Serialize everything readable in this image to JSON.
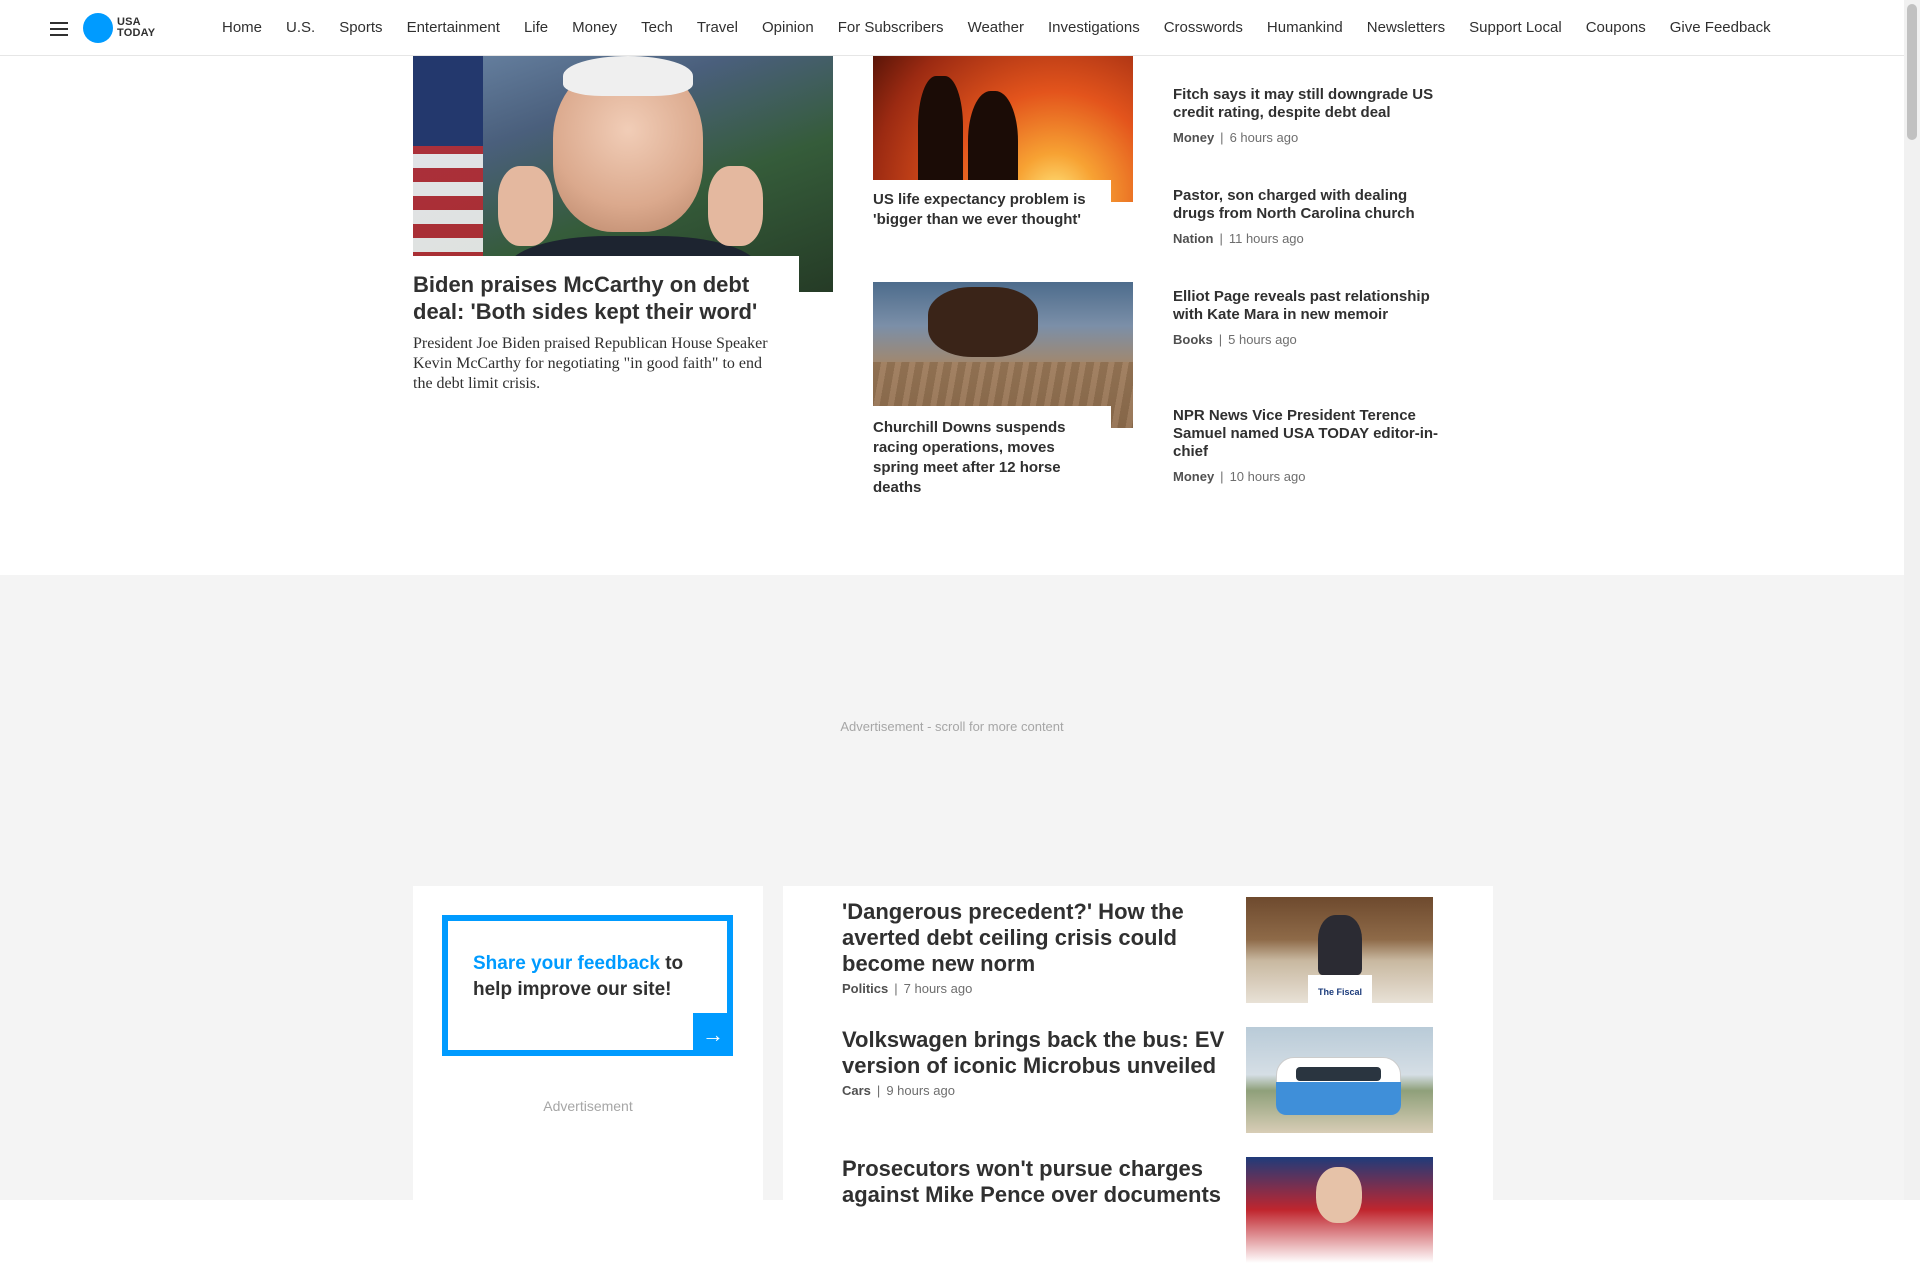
{
  "nav": {
    "logo_line1": "USA",
    "logo_line2": "TODAY",
    "links": [
      "Home",
      "U.S.",
      "Sports",
      "Entertainment",
      "Life",
      "Money",
      "Tech",
      "Travel",
      "Opinion",
      "For Subscribers",
      "Weather",
      "Investigations",
      "Crosswords",
      "Humankind",
      "Newsletters",
      "Support Local",
      "Coupons",
      "Give Feedback"
    ]
  },
  "lead": {
    "title": "Biden praises McCarthy on debt deal: 'Both sides kept their word'",
    "summary": "President Joe Biden praised Republican House Speaker Kevin McCarthy for negotiating \"in good faith\" to end the debt limit crisis."
  },
  "mid_stories": [
    {
      "title": "US life expectancy problem is 'bigger than we ever thought'"
    },
    {
      "title": "Churchill Downs suspends racing operations, moves spring meet after 12 horse deaths"
    }
  ],
  "right_stories": [
    {
      "title": "Fitch says it may still downgrade US credit rating, despite debt deal",
      "category": "Money",
      "time": "6 hours ago"
    },
    {
      "title": "Pastor, son charged with dealing drugs from North Carolina church",
      "category": "Nation",
      "time": "11 hours ago"
    },
    {
      "title": "Elliot Page reveals past relationship with Kate Mara in new memoir",
      "category": "Books",
      "time": "5 hours ago"
    },
    {
      "title": "NPR News Vice President Terence Samuel named USA TODAY editor-in-chief",
      "category": "Money",
      "time": "10 hours ago"
    }
  ],
  "ad": {
    "banner_label": "Advertisement - scroll for more content",
    "side_label": "Advertisement"
  },
  "feedback": {
    "highlight": "Share your feedback",
    "rest": " to help improve our site!",
    "arrow": "→"
  },
  "news": [
    {
      "title": "'Dangerous precedent?' How the averted debt ceiling crisis could become new norm",
      "category": "Politics",
      "time": "7 hours ago",
      "image_caption": "The Fiscal"
    },
    {
      "title": "Volkswagen brings back the bus: EV version of iconic Microbus unveiled",
      "category": "Cars",
      "time": "9 hours ago"
    },
    {
      "title": "Prosecutors won't pursue charges against Mike Pence over documents"
    }
  ],
  "colors": {
    "accent": "#009bff",
    "text": "#303030",
    "meta": "#6e6e6e",
    "ad_bg": "#f4f4f4"
  },
  "icons": {
    "menu": "hamburger-icon",
    "arrow": "arrow-right-icon"
  }
}
